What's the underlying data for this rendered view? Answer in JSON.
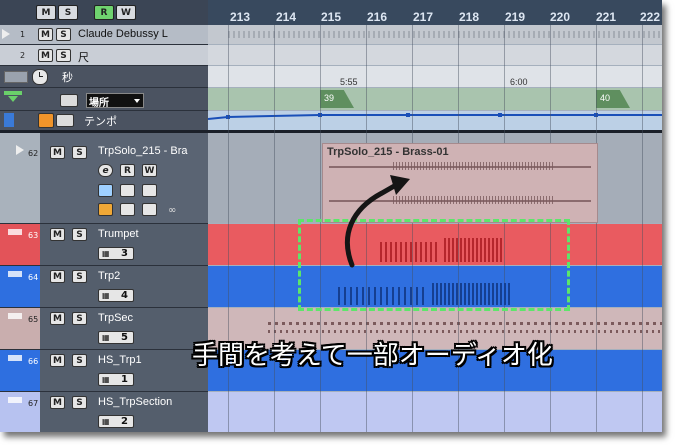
{
  "toolbar": {
    "group1": [
      "M",
      "S"
    ],
    "group2": [
      "R",
      "W"
    ]
  },
  "ruler": {
    "bars": [
      "213",
      "214",
      "215",
      "216",
      "217",
      "218",
      "219",
      "220",
      "221",
      "222"
    ]
  },
  "tracks": {
    "claude": {
      "number": "1",
      "name": "Claude Debussy L"
    },
    "shaku": {
      "number": "2",
      "name": "尺"
    },
    "seconds": {
      "name": "秒"
    },
    "marker": {
      "name": "場所"
    },
    "tempo": {
      "name": "テンポ"
    },
    "trpsolo": {
      "number": "62",
      "name": "TrpSolo_215 - Bra"
    },
    "trumpet": {
      "number": "63",
      "name": "Trumpet",
      "output": "3"
    },
    "trp2": {
      "number": "64",
      "name": "Trp2",
      "output": "4"
    },
    "trpsec": {
      "number": "65",
      "name": "TrpSec",
      "output": "5"
    },
    "hstrp1": {
      "number": "66",
      "name": "HS_Trp1",
      "output": "1"
    },
    "hstrpsec": {
      "number": "67",
      "name": "HS_TrpSection",
      "output": "2"
    }
  },
  "buttons": {
    "mute": "M",
    "solo": "S",
    "edit": "e",
    "read": "R",
    "write": "W"
  },
  "timeline": {
    "time1": "5:55",
    "time2": "6:00",
    "marker1": "39",
    "marker2": "40"
  },
  "event": {
    "title": "TrpSolo_215 - Brass-01"
  },
  "caption": "手間を考えて一部オーディオ化",
  "colors": {
    "red": "#e8575c",
    "blue": "#2f6fe0",
    "pink": "#c2a8aa",
    "lavender": "#bfc8f2"
  }
}
